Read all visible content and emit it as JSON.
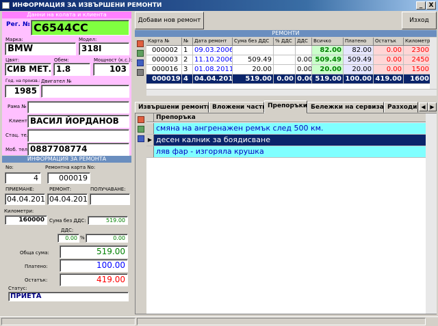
{
  "window": {
    "title": "ИНФОРМАЦИЯ ЗА ИЗВЪРШЕНИ РЕМОНТИ",
    "minimize": "_",
    "close": "X"
  },
  "client": {
    "header": "Данни на колата и клиента",
    "reg_label": "Рег. №",
    "reg_value": "С6544СС",
    "make_label": "Марка:",
    "make_value": "BMW",
    "model_label": "Модел:",
    "model_value": "318I",
    "color_label": "Цвят:",
    "color_value": "СИВ МЕТ.",
    "volume_label": "Обем:",
    "volume_value": "1.8",
    "power_label": "Мощност (к.с.):",
    "power_value": "103",
    "year_label": "Год. на произв.:",
    "year_value": "1985",
    "engine_label": "Двигател №",
    "engine_value": "",
    "frame_label": "Рама №",
    "frame_value": "",
    "client_label": "Клиент:",
    "client_value": "ВАСИЛ ЙОРДАНОВ",
    "phone_label": "Стац. тел.:",
    "phone_value": "",
    "mobile_label": "Моб. тел.:",
    "mobile_value": "0887708774"
  },
  "repair": {
    "header": "ИНФОРМАЦИЯ ЗА РЕМОНТА",
    "no_label": "No:",
    "no_value": "4",
    "card_label": "Ремонтна карта No:",
    "card_value": "000019",
    "accept_label": "ПРИЕМАНЕ:",
    "accept_value": "04.04.2012",
    "repair_label": "РЕМОНТ:",
    "repair_value": "04.04.2012",
    "receive_label": "ПОЛУЧАВАНЕ:",
    "receive_value": "",
    "km_label": "Километри:",
    "km_value": "160000",
    "novat_label": "Сума без ДДС:",
    "novat_value": "519.00",
    "vat_label": "ДДС:",
    "vat_pct": "0.00",
    "pct_sign": "%",
    "vat_value": "0.00",
    "total_label": "Обща сума:",
    "total_value": "519.00",
    "paid_label": "Платено:",
    "paid_value": "100.00",
    "rest_label": "Остатък:",
    "rest_value": "419.00",
    "status_label": "Статус:",
    "status_value": "ПРИЕТА"
  },
  "toolbar": {
    "add_repair": "Добави нов ремонт",
    "exit": "Изход"
  },
  "repairs_grid": {
    "title": "РЕМОНТИ",
    "columns": [
      "Карта №",
      "№",
      "Дата ремонт",
      "Сума без ДДС",
      "% ДДС",
      "ДДС",
      "Всичко",
      "Платено",
      "Остатък",
      "Километри"
    ],
    "rows": [
      [
        "000002",
        "1",
        "09.03.2006",
        "",
        "",
        "",
        "82.00",
        "82.00",
        "0.00",
        "2300"
      ],
      [
        "000003",
        "2",
        "11.10.2006",
        "509.49",
        "",
        "0.00",
        "509.49",
        "509.49",
        "0.00",
        "2450"
      ],
      [
        "000016",
        "3",
        "01.08.2011",
        "20.00",
        "",
        "0.00",
        "20.00",
        "20.00",
        "0.00",
        "1500"
      ],
      [
        "000019",
        "4",
        "04.04.2012",
        "519.00",
        "0.00",
        "0.00",
        "519.00",
        "100.00",
        "419.00",
        "1600"
      ]
    ]
  },
  "tabs": [
    "Извършени ремонти",
    "Вложени части",
    "Препоръки",
    "Бележки на сервиза",
    "Разходи"
  ],
  "recommendations": {
    "column": "Препоръка",
    "rows": [
      "смяна на ангренажен ремък след 500 км.",
      "десен калник за боядисване",
      "ляв фар - изгоряла крушка"
    ]
  },
  "colors": {
    "accent": "#0a246a",
    "pink": "#ffc0ff",
    "green_field": "#80ff40",
    "blue": "#0000ff",
    "red": "#ff0000",
    "dark_green": "#008000",
    "cyan_row": "#80ffff"
  }
}
